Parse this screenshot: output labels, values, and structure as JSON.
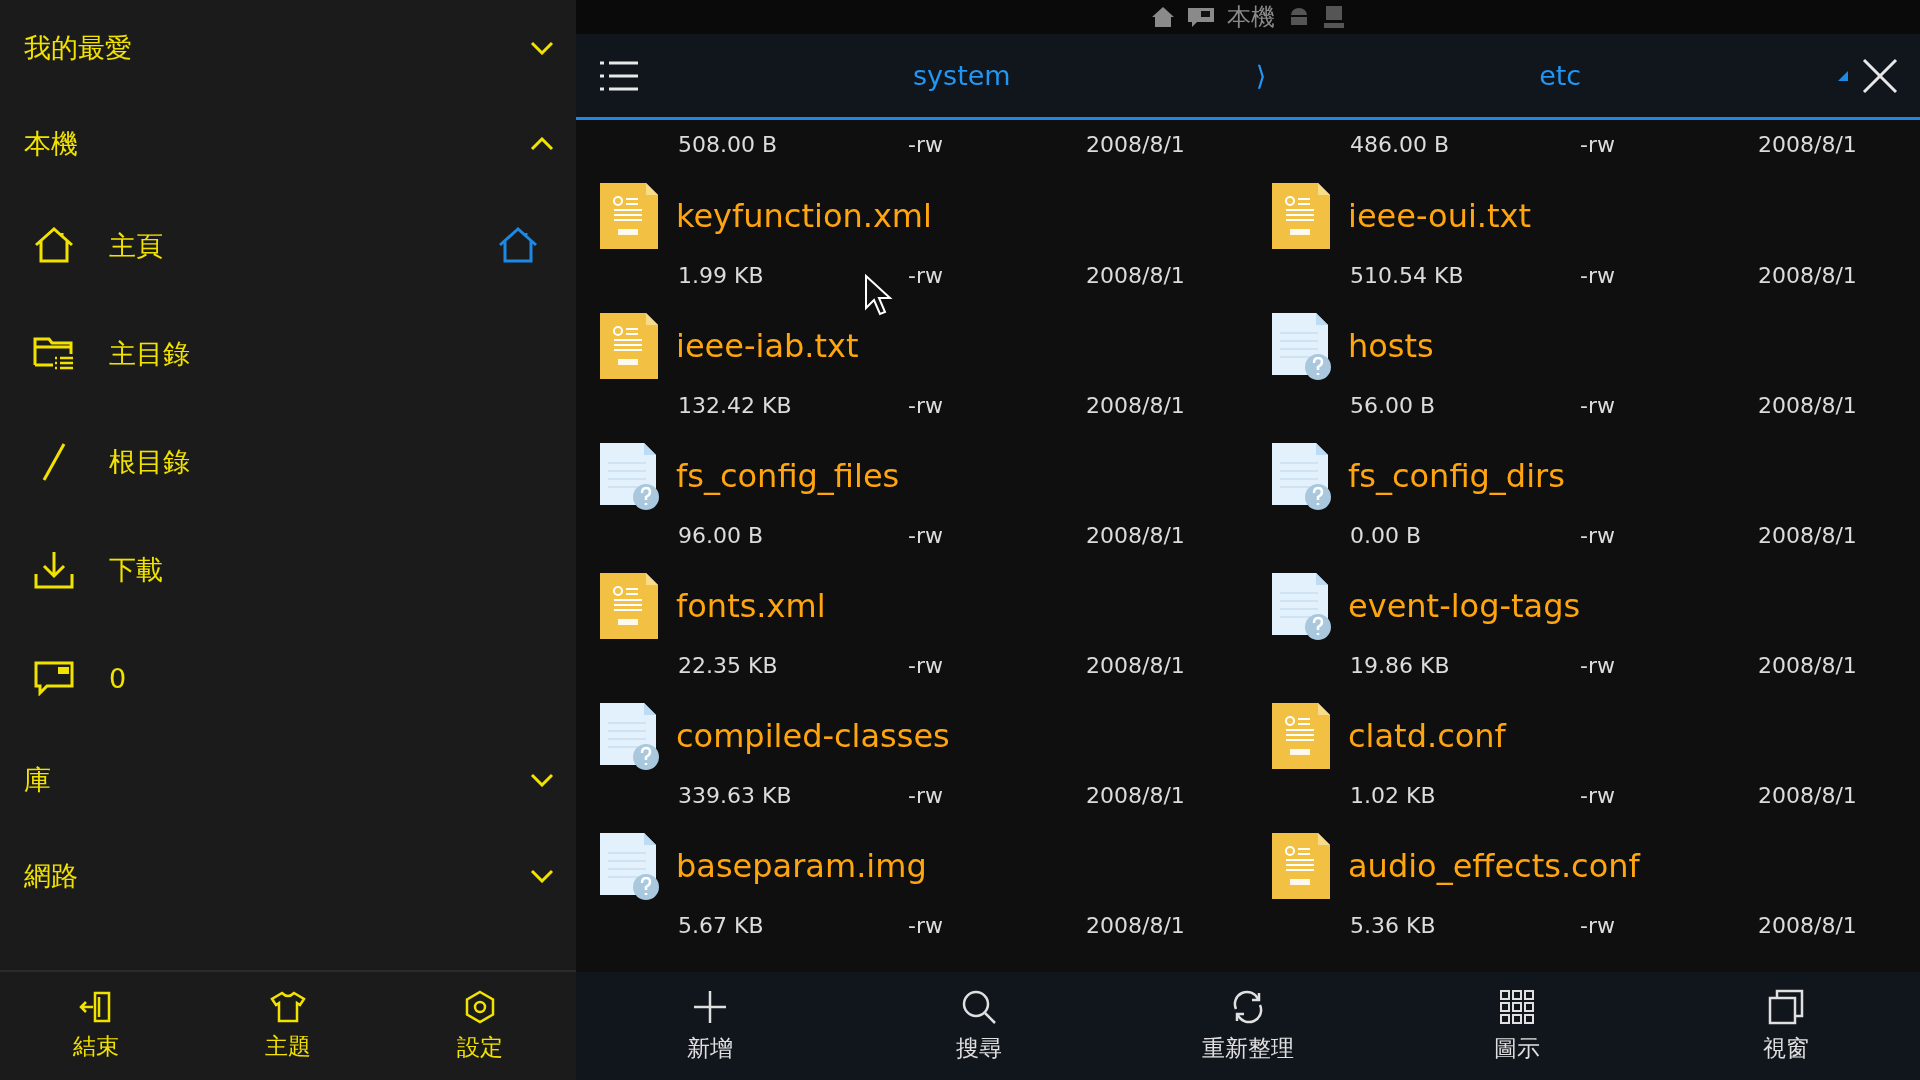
{
  "sidebar": {
    "sections": [
      {
        "label": "我的最愛",
        "expanded": false
      },
      {
        "label": "本機",
        "expanded": true,
        "items": [
          {
            "kind": "home",
            "label": "主頁",
            "default_home": true
          },
          {
            "kind": "folder",
            "label": "主目錄",
            "default_home": false
          },
          {
            "kind": "root",
            "label": "根目錄",
            "default_home": false
          },
          {
            "kind": "download",
            "label": "下載",
            "default_home": false
          },
          {
            "kind": "sdcard",
            "label": "0",
            "default_home": false
          }
        ]
      },
      {
        "label": "庫",
        "expanded": false
      },
      {
        "label": "網路",
        "expanded": false
      }
    ],
    "toolbar": [
      {
        "kind": "exit",
        "label": "結束"
      },
      {
        "kind": "theme",
        "label": "主題"
      },
      {
        "kind": "settings",
        "label": "設定"
      }
    ]
  },
  "status_bar": {
    "label": "本機"
  },
  "path": {
    "segments": [
      "system",
      "etc"
    ],
    "separator": "⟩"
  },
  "scrolled_row": [
    {
      "size": "508.00 B",
      "perm": "-rw",
      "date": "2008/8/1"
    },
    {
      "size": "486.00 B",
      "perm": "-rw",
      "date": "2008/8/1"
    }
  ],
  "files": [
    {
      "kind": "txt",
      "name": "keyfunction.xml",
      "size": "1.99 KB",
      "perm": "-rw",
      "date": "2008/8/1"
    },
    {
      "kind": "txt",
      "name": "ieee-oui.txt",
      "size": "510.54 KB",
      "perm": "-rw",
      "date": "2008/8/1"
    },
    {
      "kind": "txt",
      "name": "ieee-iab.txt",
      "size": "132.42 KB",
      "perm": "-rw",
      "date": "2008/8/1"
    },
    {
      "kind": "unknown",
      "name": "hosts",
      "size": "56.00 B",
      "perm": "-rw",
      "date": "2008/8/1"
    },
    {
      "kind": "unknown",
      "name": "fs_config_files",
      "size": "96.00 B",
      "perm": "-rw",
      "date": "2008/8/1"
    },
    {
      "kind": "unknown",
      "name": "fs_config_dirs",
      "size": "0.00 B",
      "perm": "-rw",
      "date": "2008/8/1"
    },
    {
      "kind": "txt",
      "name": "fonts.xml",
      "size": "22.35 KB",
      "perm": "-rw",
      "date": "2008/8/1"
    },
    {
      "kind": "unknown",
      "name": "event-log-tags",
      "size": "19.86 KB",
      "perm": "-rw",
      "date": "2008/8/1"
    },
    {
      "kind": "unknown",
      "name": "compiled-classes",
      "size": "339.63 KB",
      "perm": "-rw",
      "date": "2008/8/1"
    },
    {
      "kind": "txt",
      "name": "clatd.conf",
      "size": "1.02 KB",
      "perm": "-rw",
      "date": "2008/8/1"
    },
    {
      "kind": "unknown",
      "name": "baseparam.img",
      "size": "5.67 KB",
      "perm": "-rw",
      "date": "2008/8/1"
    },
    {
      "kind": "txt",
      "name": "audio_effects.conf",
      "size": "5.36 KB",
      "perm": "-rw",
      "date": "2008/8/1"
    }
  ],
  "toolbar": [
    {
      "kind": "add",
      "label": "新增"
    },
    {
      "kind": "search",
      "label": "搜尋"
    },
    {
      "kind": "refresh",
      "label": "重新整理"
    },
    {
      "kind": "grid",
      "label": "圖示"
    },
    {
      "kind": "windows",
      "label": "視窗"
    }
  ]
}
